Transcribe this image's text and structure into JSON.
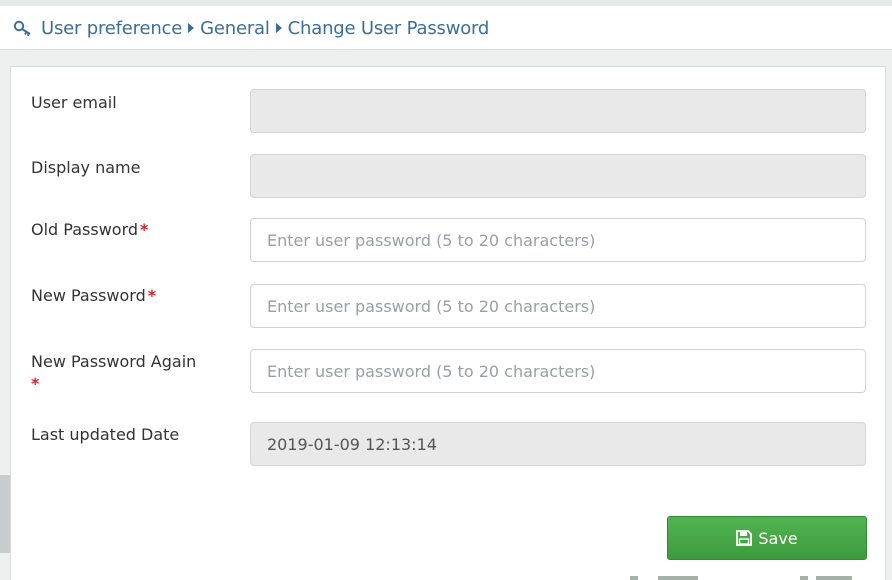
{
  "breadcrumb": {
    "icon": "key-icon",
    "items": [
      "User preference",
      "General",
      "Change User Password"
    ]
  },
  "form": {
    "user_email": {
      "label": "User email",
      "value": ""
    },
    "display_name": {
      "label": "Display name",
      "value": ""
    },
    "old_password": {
      "label": "Old Password",
      "required": "*",
      "placeholder": "Enter user password (5 to 20 characters)"
    },
    "new_password": {
      "label": "New Password",
      "required": "*",
      "placeholder": "Enter user password (5 to 20 characters)"
    },
    "new_password_again": {
      "label": "New Password Again",
      "required": "*",
      "placeholder": "Enter user password (5 to 20 characters)"
    },
    "last_updated": {
      "label": "Last updated Date",
      "value": "2019-01-09 12:13:14"
    }
  },
  "save_button": {
    "label": "Save",
    "icon": "floppy-disk-icon",
    "color": "#46a846"
  },
  "colors": {
    "breadcrumb": "#3a6f9a",
    "required": "#d9232d",
    "disabled_field": "#e9e9e9"
  }
}
